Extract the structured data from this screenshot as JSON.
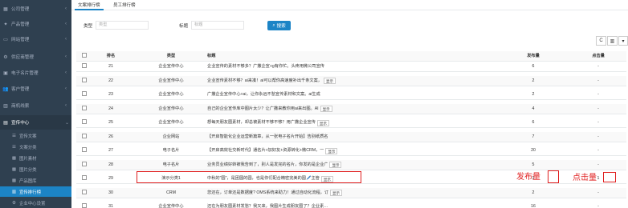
{
  "sidebar": {
    "items": [
      {
        "label": "公司管理",
        "icon": "building-icon",
        "glyph": "▦"
      },
      {
        "label": "产品管理",
        "icon": "cart-icon",
        "glyph": "✦"
      },
      {
        "label": "网站管理",
        "icon": "monitor-icon",
        "glyph": "▭"
      },
      {
        "label": "供应商管理",
        "icon": "gear-icon",
        "glyph": "⚙"
      },
      {
        "label": "电子名片管理",
        "icon": "card-icon",
        "glyph": "▣"
      },
      {
        "label": "客户管理",
        "icon": "user-icon",
        "glyph": "👥"
      },
      {
        "label": "商机线索",
        "icon": "chart-icon",
        "glyph": "▥"
      },
      {
        "label": "宣传中心",
        "icon": "grid-icon",
        "glyph": "▤"
      }
    ],
    "subitems": [
      {
        "label": "宣传文案",
        "icon": "list-icon",
        "glyph": "☰"
      },
      {
        "label": "文案分类",
        "icon": "list-icon",
        "glyph": "☰"
      },
      {
        "label": "图片素材",
        "icon": "image-icon",
        "glyph": "▩"
      },
      {
        "label": "图片分类",
        "icon": "image-icon",
        "glyph": "▩"
      },
      {
        "label": "产品图库",
        "icon": "image-icon",
        "glyph": "▩"
      },
      {
        "label": "宣传排行榜",
        "icon": "chart-icon",
        "glyph": "▥"
      },
      {
        "label": "企业中心设置",
        "icon": "gear-icon",
        "glyph": "⚙"
      }
    ]
  },
  "tabs": [
    "文案排行榜",
    "员工排行榜"
  ],
  "filters": {
    "type_label": "类型",
    "type_placeholder": "类型",
    "title_label": "标题",
    "title_placeholder": "标题",
    "search_label": "搜索"
  },
  "toolbar": {
    "refresh_glyph": "C",
    "columns_glyph": "▥",
    "more_glyph": "▾"
  },
  "table": {
    "headers": {
      "rank": "排名",
      "type": "类型",
      "title": "标题",
      "count": "发布量",
      "clicks": "点击量"
    },
    "show_label": "显示",
    "rows": [
      {
        "rank": "21",
        "type": "企业宣传中心",
        "title": "企业宣传的素材不够多？广撒企宣+g有你忙。头疼用微公司宣传",
        "count": "6",
        "clicks": "-",
        "show": false
      },
      {
        "rank": "22",
        "type": "企业宣传中心",
        "title": "企业宣传素材不够？ai来凑！ai可以帮你高速度补出千条文案，",
        "count": "2",
        "clicks": "-",
        "show": true
      },
      {
        "rank": "23",
        "type": "企业宣传中心",
        "title": "广撒企业宣传中心+ai，让你永远不愁宣传素材和文案。ai生成",
        "count": "2",
        "clicks": "-",
        "show": false
      },
      {
        "rank": "24",
        "type": "企业宣传中心",
        "title": "自己的企业宣传库中图片太少？让广撒来教你用ai来出图。AI",
        "count": "4",
        "clicks": "-",
        "show": true
      },
      {
        "rank": "25",
        "type": "企业宣传中心",
        "title": "想每天朋友圈素材，却总被素材不够不够？用广撒企业宣传",
        "count": "6",
        "clicks": "-",
        "show": true
      },
      {
        "rank": "26",
        "type": "企业网站",
        "title": "【开启智能化企业运营新篇章，从一张电子名片开始】告别纸质名",
        "count": "7",
        "clicks": "-",
        "show": false
      },
      {
        "rank": "27",
        "type": "电子名片",
        "title": "【开启高效社交新时代】通名片+加好友+资源转化+微CRM，一",
        "count": "20",
        "clicks": "-",
        "show": true
      },
      {
        "rank": "28",
        "type": "电子名片",
        "title": "业务员业绩好转被我告到了，别人是发完的名片，你发的是企业广",
        "count": "5",
        "clicks": "-",
        "show": true
      },
      {
        "rank": "29",
        "type": "演示分类1",
        "title": "中秋的\"圆\"，是团圆的圆，也是你们配合精密完美的圆🖊️主管",
        "count": "1",
        "clicks": "1",
        "show": true
      },
      {
        "rank": "30",
        "type": "CRM",
        "title": "您还在，订单还是数据度? OMS系统来助力！通过自动化流程，订",
        "count": "2",
        "clicks": "-",
        "show": true
      },
      {
        "rank": "31",
        "type": "企业宣传中心",
        "title": "还在为朋友圈素材发愁？我又来，我图片生成朋友圈了？企业素材库",
        "count": "16",
        "clicks": "-",
        "show": false
      }
    ]
  },
  "annotations": {
    "count_label": "发布量",
    "clicks_label": "点击量"
  },
  "colors": {
    "sidebar_bg": "#2f4050",
    "accent": "#1c84c6",
    "highlight": "#e02020"
  }
}
